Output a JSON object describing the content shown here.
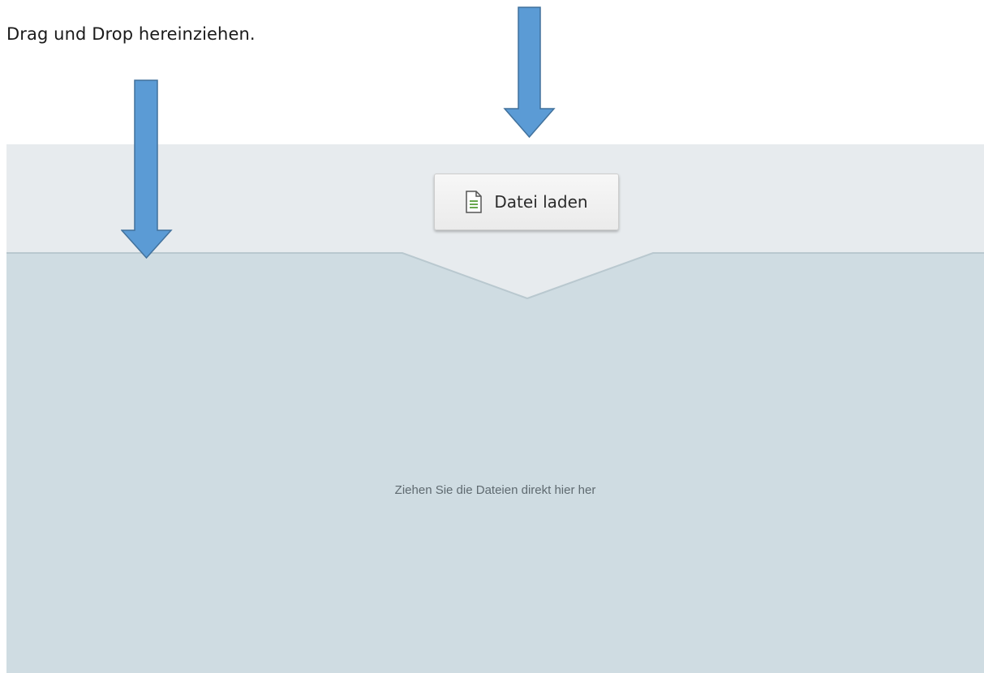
{
  "instruction": {
    "text": "Drag und Drop hereinziehen."
  },
  "uploader": {
    "load_button_label": "Datei laden",
    "load_button_icon": "document-icon",
    "drop_hint": "Ziehen Sie die Dateien direkt hier her"
  },
  "annotations": {
    "arrow_color": "#5b9bd5",
    "arrow_outline": "#41719c",
    "arrows": [
      "down-arrow-to-button",
      "down-arrow-to-dropzone"
    ]
  },
  "colors": {
    "header_bg": "#e7ebee",
    "dropzone_bg": "#cfdce2"
  }
}
